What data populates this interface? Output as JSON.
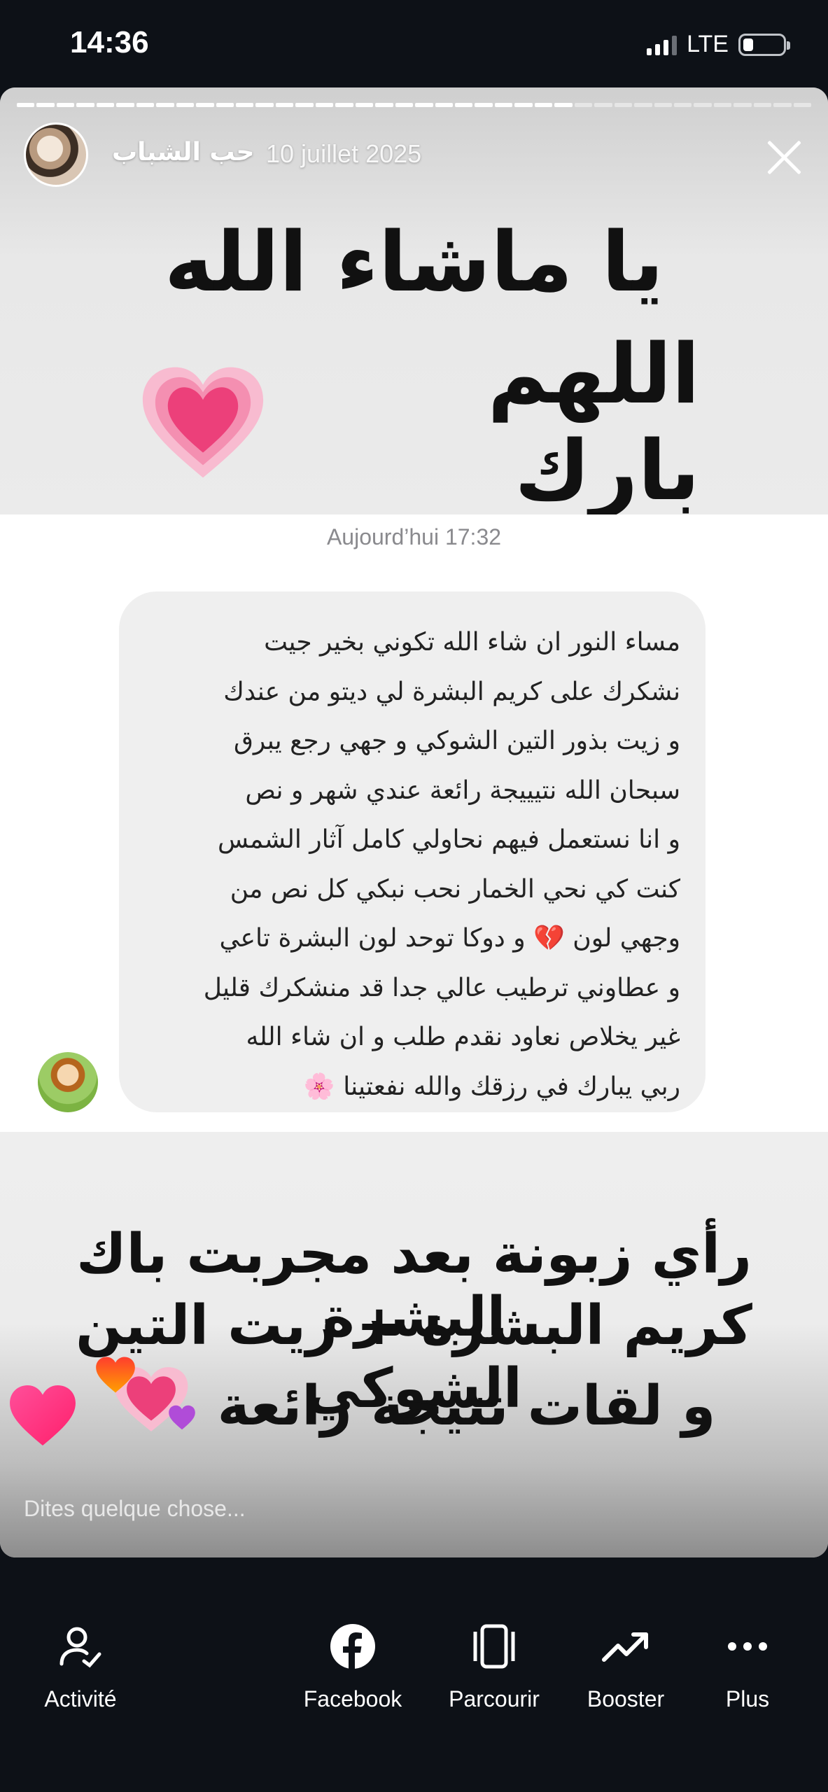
{
  "status_bar": {
    "time": "14:36",
    "network": "LTE"
  },
  "story": {
    "account_name": "حب الشباب",
    "date": "10 juillet 2025",
    "progress_segments_total": 40,
    "progress_segments_done": 28,
    "headline_line1": "يا ماشاء الله",
    "headline_line2": "اللهم بارك",
    "chat": {
      "timestamp": "Aujourd’hui 17:32",
      "message_lines": [
        "مساء النور ان شاء الله تكوني بخير جيت",
        "نشكرك على كريم البشرة لي ديتو من عندك",
        "و زيت بذور التين الشوكي و جهي رجع يبرق",
        "سبحان الله نتيييجة رائعة عندي شهر و نص",
        "و انا نستعمل فيهم نحاولي كامل آثار الشمس",
        "كنت كي نحي الخمار نحب نبكي كل نص من",
        "وجهي لون 💔 و دوكا توحد لون البشرة تاعي",
        "و عطاوني ترطيب عالي جدا قد منشكرك قليل",
        "غير يخلاص نعاود نقدم طلب و ان شاء الله",
        "ربي يبارك في رزقك والله نفعتينا 🌸"
      ]
    },
    "caption_line1": "رأي زبونة بعد مجربت باك البشرة",
    "caption_line2": "كريم البشرة + زيت التين الشوكي",
    "caption_line3": "و لقات نتيجة رائعة",
    "reply_placeholder": "Dites quelque chose..."
  },
  "bottom_nav": {
    "items": [
      {
        "label": "Activité",
        "icon": "activity-icon"
      },
      {
        "label": "Facebook",
        "icon": "facebook-icon"
      },
      {
        "label": "Parcourir",
        "icon": "browse-icon"
      },
      {
        "label": "Booster",
        "icon": "trending-up-icon"
      },
      {
        "label": "Plus",
        "icon": "more-icon"
      }
    ]
  },
  "colors": {
    "background": "#0d1117",
    "heart_pink": "#ec407a",
    "heart_light": "#f8bbd0"
  }
}
